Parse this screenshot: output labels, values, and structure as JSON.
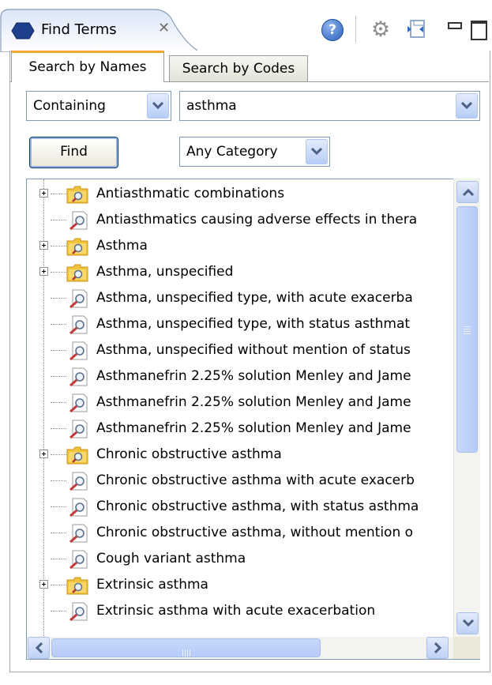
{
  "view": {
    "title": "Find Terms",
    "close_glyph": "✕",
    "toolbar": {
      "help_icon": "help-icon",
      "help_glyph": "?",
      "settings_icon": "gear-icon",
      "link_icon": "link-with-editor-icon",
      "minimize_icon": "minimize-icon",
      "maximize_icon": "maximize-icon"
    }
  },
  "tabs": [
    {
      "label": "Search by Names",
      "active": true
    },
    {
      "label": "Search by Codes",
      "active": false
    }
  ],
  "search": {
    "match_mode": "Containing",
    "query": "asthma",
    "find_label": "Find",
    "category": "Any Category"
  },
  "results": [
    {
      "label": "Antiasthmatic combinations",
      "type": "folder",
      "expandable": true
    },
    {
      "label": "Antiasthmatics causing adverse effects in thera",
      "type": "term",
      "expandable": false
    },
    {
      "label": "Asthma",
      "type": "folder",
      "expandable": true
    },
    {
      "label": "Asthma, unspecified",
      "type": "folder",
      "expandable": true
    },
    {
      "label": "Asthma, unspecified type, with acute exacerba",
      "type": "term",
      "expandable": false
    },
    {
      "label": "Asthma, unspecified type, with status asthmat",
      "type": "term",
      "expandable": false
    },
    {
      "label": "Asthma, unspecified without mention of status",
      "type": "term",
      "expandable": false
    },
    {
      "label": "Asthmanefrin 2.25% solution Menley and Jame",
      "type": "term",
      "expandable": false
    },
    {
      "label": "Asthmanefrin 2.25% solution Menley and Jame",
      "type": "term",
      "expandable": false
    },
    {
      "label": "Asthmanefrin 2.25% solution Menley and Jame",
      "type": "term",
      "expandable": false
    },
    {
      "label": "Chronic obstructive asthma",
      "type": "folder",
      "expandable": true
    },
    {
      "label": "Chronic obstructive asthma with acute exacerb",
      "type": "term",
      "expandable": false
    },
    {
      "label": "Chronic obstructive asthma, with status asthma",
      "type": "term",
      "expandable": false
    },
    {
      "label": "Chronic obstructive asthma, without mention o",
      "type": "term",
      "expandable": false
    },
    {
      "label": "Cough variant asthma",
      "type": "term",
      "expandable": false
    },
    {
      "label": "Extrinsic asthma",
      "type": "folder",
      "expandable": true
    },
    {
      "label": "Extrinsic asthma with acute exacerbation",
      "type": "term",
      "expandable": false
    }
  ],
  "colors": {
    "active_tab_accent": "#f4a633",
    "folder": "#f2c33c",
    "scrollbar": "#b6cbf7"
  }
}
